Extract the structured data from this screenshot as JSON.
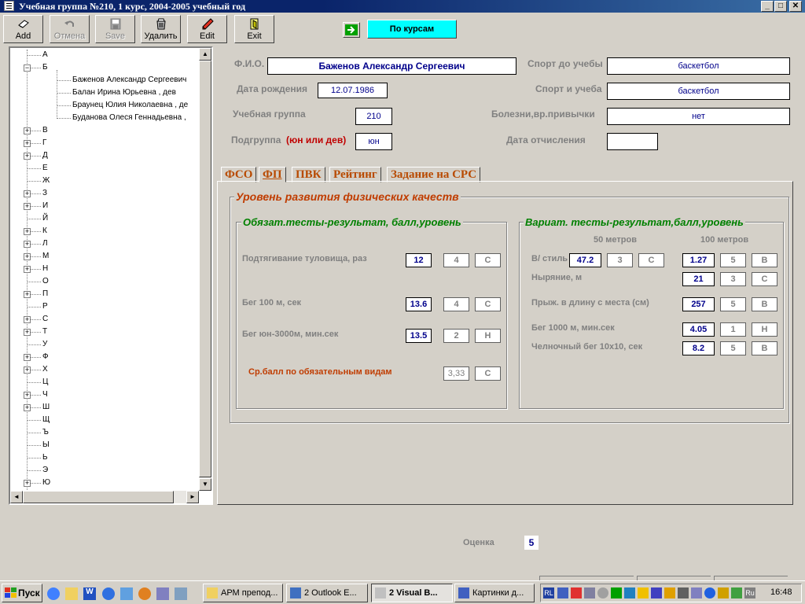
{
  "window": {
    "title": "Учебная группа №210, 1 курс, 2004-2005 учебный год",
    "min": "_",
    "max": "□",
    "close": "✕"
  },
  "toolbar": {
    "add": "Add",
    "cancel": "Отмена",
    "save": "Save",
    "delete": "Удалить",
    "edit": "Edit",
    "exit": "Exit",
    "by_courses": "По курсам"
  },
  "tree": {
    "letters": [
      "А",
      "Б",
      "В",
      "Г",
      "Д",
      "Е",
      "Ж",
      "З",
      "И",
      "Й",
      "К",
      "Л",
      "М",
      "Н",
      "О",
      "П",
      "Р",
      "С",
      "Т",
      "У",
      "Ф",
      "Х",
      "Ц",
      "Ч",
      "Ш",
      "Щ",
      "Ъ",
      "Ы",
      "Ь",
      "Э",
      "Ю"
    ],
    "students": [
      "Баженов Александр Сергеевич",
      "Балан Ирина Юрьевна , дев",
      "Браунец Юлия Николаевна , де",
      "Буданова Олеся Геннадьевна ,"
    ]
  },
  "form": {
    "fio_label": "Ф.И.О.",
    "fio": "Баженов Александр Сергеевич",
    "birth_label": "Дата рождения",
    "birth": "12.07.1986",
    "group_label": "Учебная группа",
    "group": "210",
    "subgroup_label": "Подгруппа",
    "subgroup_hint": "(юн или дев)",
    "subgroup": "юн",
    "sport_before_label": "Спорт до учебы",
    "sport_before": "баскетбол",
    "sport_study_label": "Спорт и учеба",
    "sport_study": "баскетбол",
    "illness_label": "Болезни,вр.привычки",
    "illness": "нет",
    "expel_label": "Дата отчисления",
    "expel": ""
  },
  "tabs": [
    "ФСО",
    "ФП",
    "ПВК",
    "Рейтинг",
    "Задание на СРС"
  ],
  "fp": {
    "title": "Уровень развития физических качеств",
    "mandatory": {
      "title": "Обязат.тесты-результат, балл,уровень",
      "rows": [
        {
          "label": "Подтягивание туловища, раз",
          "result": "12",
          "score": "4",
          "level": "С"
        },
        {
          "label": "Бег 100 м, сек",
          "result": "13.6",
          "score": "4",
          "level": "С"
        },
        {
          "label": "Бег юн-3000м, мин.сек",
          "result": "13.5",
          "score": "2",
          "level": "Н"
        }
      ],
      "avg_label": "Ср.балл по обязательным видам",
      "avg": "3,33",
      "avg_level": "С"
    },
    "variant": {
      "title": "Вариат. тесты-результат,балл,уровень",
      "col1": "50 метров",
      "col2": "100 метров",
      "style_label": "В/ стиль",
      "style50": {
        "result": "47.2",
        "score": "3",
        "level": "С"
      },
      "style100": {
        "result": "1.27",
        "score": "5",
        "level": "В"
      },
      "rows": [
        {
          "label": "Ныряние, м",
          "result": "21",
          "score": "3",
          "level": "С"
        },
        {
          "label": "Прыж. в длину с места (см)",
          "result": "257",
          "score": "5",
          "level": "В"
        },
        {
          "label": "Бег 1000 м, мин.сек",
          "result": "4.05",
          "score": "1",
          "level": "Н"
        },
        {
          "label": "Челночный бег 10х10, сек",
          "result": "8.2",
          "score": "5",
          "level": "В"
        }
      ]
    }
  },
  "grade": {
    "label": "Оценка",
    "value": "5"
  },
  "taskbar": {
    "start": "Пуск",
    "tasks": [
      "АРМ препод...",
      "2 Outlook E...",
      "2 Visual B...",
      "Картинки д..."
    ],
    "lang": "RL",
    "lang2": "Ru",
    "clock": "16:48"
  }
}
